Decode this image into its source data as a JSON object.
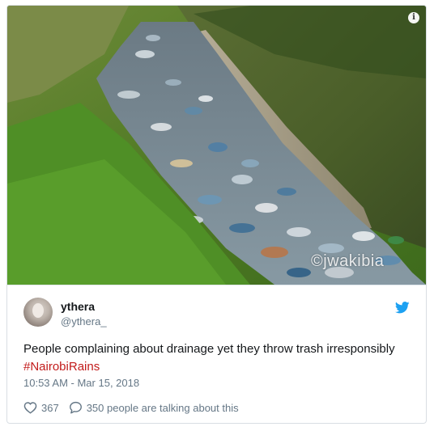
{
  "media": {
    "info_icon": "info-icon",
    "watermark": "©jwakibia"
  },
  "tweet": {
    "display_name": "ythera",
    "handle": "@ythera_",
    "text_main": "People complaining about drainage yet they throw trash irresponsibly ",
    "hashtag": "#NairobiRains",
    "timestamp": "10:53 AM - Mar 15, 2018",
    "likes_count": "367",
    "replies_label": "350 people are talking about this",
    "brand_icon": "twitter-bird-icon",
    "colors": {
      "brand": "#1da1f2",
      "hashtag": "#c21b1b",
      "muted": "#657786",
      "text": "#14171a"
    }
  }
}
